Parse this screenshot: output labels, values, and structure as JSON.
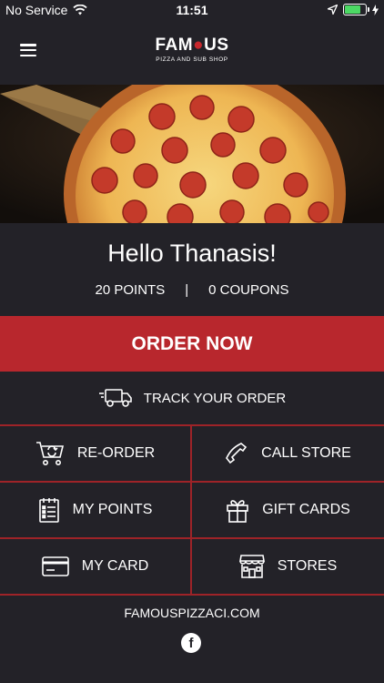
{
  "status_bar": {
    "carrier": "No Service",
    "time": "11:51",
    "battery_level": 0.75,
    "battery_color": "#4cd964"
  },
  "header": {
    "logo_text_a": "FAM",
    "logo_text_b": "US",
    "logo_tagline": "PIZZA AND SUB SHOP",
    "menu_icon": "hamburger-menu-icon"
  },
  "hero": {
    "subject": "pepperoni pizza"
  },
  "greeting": "Hello Thanasis!",
  "stats": {
    "points": "20 POINTS",
    "separator": "|",
    "coupons": "0 COUPONS"
  },
  "order_now_label": "ORDER NOW",
  "track_label": "TRACK YOUR ORDER",
  "menu_grid": [
    {
      "label": "RE-ORDER",
      "icon": "cart-refresh-icon"
    },
    {
      "label": "CALL STORE",
      "icon": "phone-icon"
    },
    {
      "label": "MY POINTS",
      "icon": "clipboard-list-icon"
    },
    {
      "label": "GIFT CARDS",
      "icon": "gift-icon"
    },
    {
      "label": "MY CARD",
      "icon": "credit-card-icon"
    },
    {
      "label": "STORES",
      "icon": "storefront-icon"
    }
  ],
  "footer": {
    "website": "FAMOUSPIZZACI.COM",
    "facebook_glyph": "f"
  },
  "colors": {
    "background": "#232228",
    "accent_red": "#b8272d",
    "divider_red": "#9e2328"
  }
}
